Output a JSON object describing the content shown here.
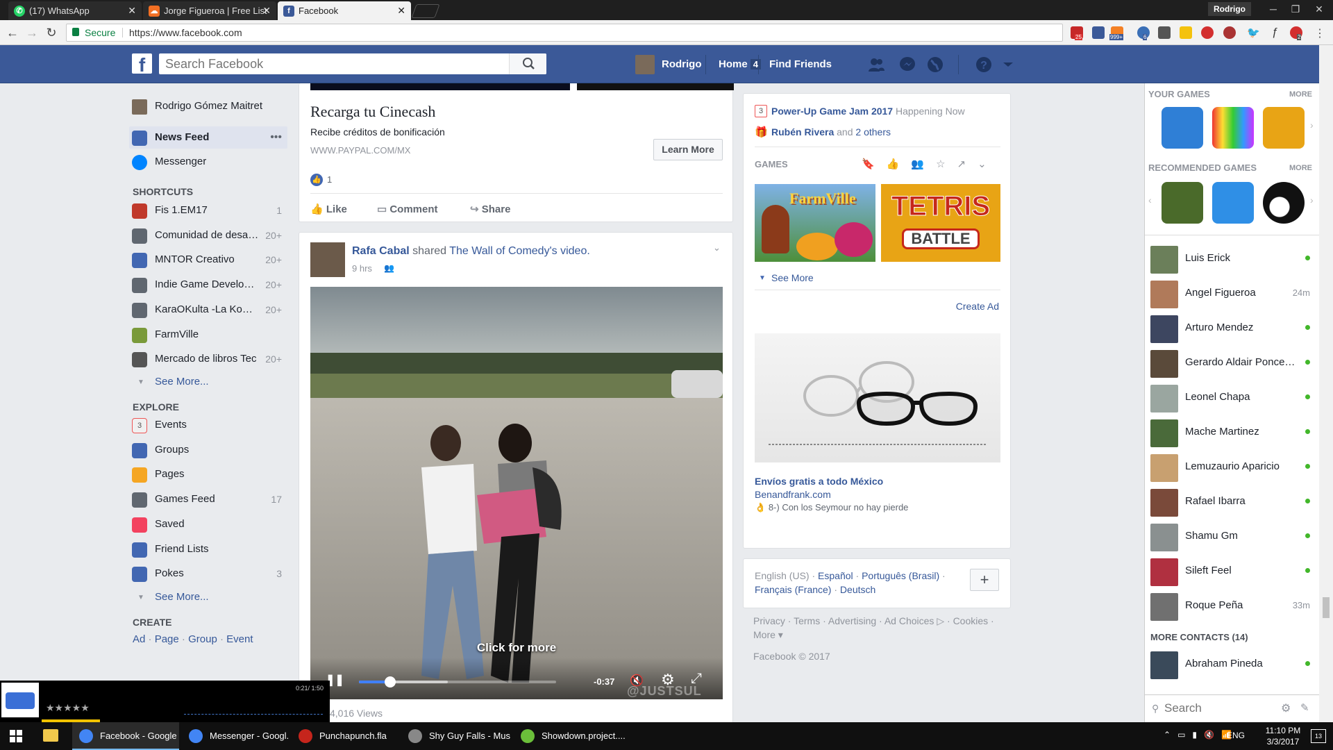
{
  "browser": {
    "tabs": [
      {
        "label": "(17) WhatsApp",
        "icon": "whatsapp-icon"
      },
      {
        "label": "Jorge Figueroa | Free List",
        "icon": "soundcloud-icon"
      },
      {
        "label": "Facebook",
        "icon": "facebook-icon"
      }
    ],
    "user": "Rodrigo",
    "secure": "Secure",
    "url": "https://www.facebook.com",
    "ext_badges": [
      "25",
      "999+",
      "6",
      "2"
    ]
  },
  "fb": {
    "logo": "f",
    "search_placeholder": "Search Facebook",
    "profile_name": "Rodrigo",
    "home_label": "Home",
    "home_count": "4",
    "find_friends": "Find Friends"
  },
  "left": {
    "profile": "Rodrigo Gómez Maitret",
    "news_feed": "News Feed",
    "news_feed_more": "•••",
    "messenger": "Messenger",
    "shortcuts_title": "SHORTCUTS",
    "shortcuts": [
      {
        "label": "Fis 1.EM17",
        "count": "1",
        "color": "#c0392b"
      },
      {
        "label": "Comunidad de desarr...",
        "count": "20+",
        "color": "#606770"
      },
      {
        "label": "MNTOR Creativo",
        "count": "20+",
        "color": "#4267b2"
      },
      {
        "label": "Indie Game Developers",
        "count": "20+",
        "color": "#606770"
      },
      {
        "label": "KaraOKulta -La Komu...",
        "count": "20+",
        "color": "#606770"
      },
      {
        "label": "FarmVille",
        "count": "",
        "color": "#7a9a3a"
      },
      {
        "label": "Mercado de libros Tec",
        "count": "20+",
        "color": "#555"
      }
    ],
    "see_more": "See More...",
    "explore_title": "EXPLORE",
    "explore": [
      {
        "label": "Events",
        "count": "",
        "color": "#f0f0f0"
      },
      {
        "label": "Groups",
        "count": "",
        "color": "#4267b2"
      },
      {
        "label": "Pages",
        "count": "",
        "color": "#f5a623"
      },
      {
        "label": "Games Feed",
        "count": "17",
        "color": "#606770"
      },
      {
        "label": "Saved",
        "count": "",
        "color": "#f3425f"
      },
      {
        "label": "Friend Lists",
        "count": "",
        "color": "#4267b2"
      },
      {
        "label": "Pokes",
        "count": "3",
        "color": "#4267b2"
      }
    ],
    "see_more2": "See More...",
    "create_title": "CREATE",
    "create_links": [
      "Ad",
      "Page",
      "Group",
      "Event"
    ],
    "events_day": "3"
  },
  "ad_post": {
    "title": "Recarga tu Cinecash",
    "subtitle": "Recibe créditos de bonificación",
    "domain": "WWW.PAYPAL.COM/MX",
    "cta": "Learn More",
    "likes": "1",
    "like": "Like",
    "comment": "Comment",
    "share": "Share"
  },
  "video_post": {
    "author": "Rafa Cabal",
    "shared": "shared",
    "source": "The Wall of Comedy's",
    "video_word": "video.",
    "time": "9 hrs",
    "overlay": "Click for more",
    "remaining": "-0:37",
    "watermark": "@JUSTSUL",
    "progress": 0.16,
    "buffered": 0.45,
    "views": "4,016 Views"
  },
  "right": {
    "event_day": "3",
    "event_title": "Power-Up Game Jam 2017",
    "event_status": "Happening Now",
    "birthday_name": "Rubén Rivera",
    "birthday_and": "and",
    "birthday_others": "2 others",
    "games_title": "GAMES",
    "game1": "FarmVille",
    "game2_line1": "TETRIS",
    "game2_line2": "BATTLE",
    "see_more": "See More",
    "create_ad": "Create Ad",
    "ad_title": "Envíos gratis a todo México",
    "ad_domain": "Benandfrank.com",
    "ad_text": "8-) Con los Seymour no hay pierde",
    "languages": [
      "English (US)",
      "Español",
      "Português (Brasil)",
      "Français (France)",
      "Deutsch"
    ],
    "footer_links": [
      "Privacy",
      "Terms",
      "Advertising",
      "Ad Choices",
      "Cookies",
      "More"
    ],
    "copyright": "Facebook © 2017"
  },
  "chat": {
    "your_games": "YOUR GAMES",
    "more": "MORE",
    "recommended": "RECOMMENDED GAMES",
    "more2": "MORE",
    "contacts": [
      {
        "name": "Luis Erick",
        "status": "online",
        "color": "#6b7f5a"
      },
      {
        "name": "Angel Figueroa",
        "status": "24m",
        "color": "#b07a5a"
      },
      {
        "name": "Arturo Mendez",
        "status": "online",
        "color": "#3d4660"
      },
      {
        "name": "Gerardo Aldair Ponce ...",
        "status": "online",
        "color": "#5a4a3a"
      },
      {
        "name": "Leonel Chapa",
        "status": "online",
        "color": "#9aa6a0"
      },
      {
        "name": "Mache Martinez",
        "status": "online",
        "color": "#4a6a3a"
      },
      {
        "name": "Lemuzaurio Aparicio",
        "status": "online",
        "color": "#c8a070"
      },
      {
        "name": "Rafael Ibarra",
        "status": "online",
        "color": "#7a4a3a"
      },
      {
        "name": "Shamu Gm",
        "status": "online",
        "color": "#8a9090"
      },
      {
        "name": "Sileft Feel",
        "status": "online",
        "color": "#b03040"
      },
      {
        "name": "Roque Peña",
        "status": "33m",
        "color": "#707070"
      }
    ],
    "more_contacts": "MORE CONTACTS (14)",
    "extra_contact": {
      "name": "Abraham Pineda",
      "status": "online",
      "color": "#3a4a5a"
    },
    "search_placeholder": "Search"
  },
  "mini_player": {
    "time": "0:21/ 1:50",
    "stars": "★★★★★"
  },
  "taskbar": {
    "items": [
      {
        "label": "Facebook - Google ...",
        "color": "#4285f4",
        "active": true
      },
      {
        "label": "Messenger - Googl...",
        "color": "#4285f4",
        "active": false
      },
      {
        "label": "Punchapunch.fla",
        "color": "#c5251c",
        "active": false
      },
      {
        "label": "Shy Guy Falls - Mus...",
        "color": "#888",
        "active": false
      },
      {
        "label": "Showdown.project....",
        "color": "#6bbf3a",
        "active": false
      }
    ],
    "lang": "ENG",
    "time": "11:10 PM",
    "date": "3/3/2017",
    "notif": "13"
  }
}
